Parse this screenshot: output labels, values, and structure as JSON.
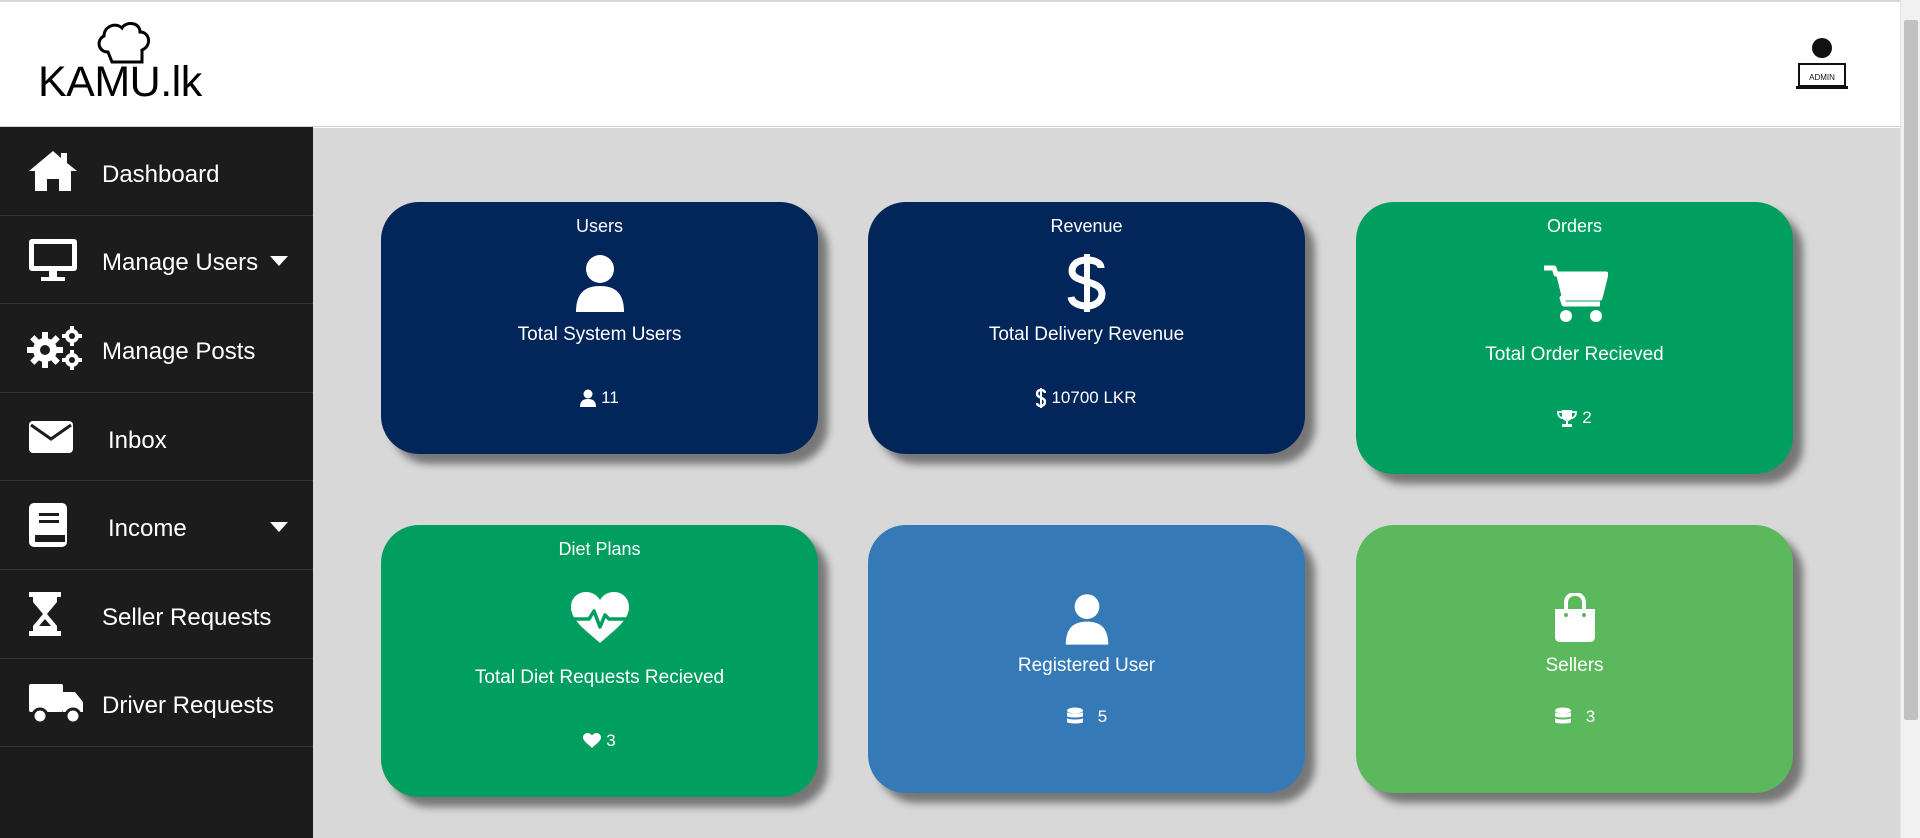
{
  "header": {
    "logo_text": "KAMU.lk",
    "avatar_label": "ADMIN"
  },
  "sidebar": {
    "items": [
      {
        "label": "Dashboard",
        "icon": "home-icon",
        "has_dropdown": false
      },
      {
        "label": "Manage Users",
        "icon": "desktop-icon",
        "has_dropdown": true
      },
      {
        "label": "Manage Posts",
        "icon": "gears-icon",
        "has_dropdown": false
      },
      {
        "label": "Inbox",
        "icon": "envelope-icon",
        "has_dropdown": false
      },
      {
        "label": "Income",
        "icon": "book-icon",
        "has_dropdown": true
      },
      {
        "label": "Seller Requests",
        "icon": "hourglass-icon",
        "has_dropdown": false
      },
      {
        "label": "Driver Requests",
        "icon": "truck-icon",
        "has_dropdown": false
      }
    ]
  },
  "cards": [
    {
      "title": "Users",
      "subtitle": "Total System Users",
      "value": "11",
      "icon": "user-icon",
      "stat_icon": "user-icon",
      "color": "#02265a"
    },
    {
      "title": "Revenue",
      "subtitle": "Total Delivery Revenue",
      "value": "10700 LKR",
      "icon": "dollar-icon",
      "stat_icon": "dollar-icon",
      "color": "#02265a"
    },
    {
      "title": "Orders",
      "subtitle": "Total Order Recieved",
      "value": "2",
      "icon": "cart-icon",
      "stat_icon": "trophy-icon",
      "color": "#019f5f"
    },
    {
      "title": "Diet Plans",
      "subtitle": "Total Diet Requests Recieved",
      "value": "3",
      "icon": "heartbeat-icon",
      "stat_icon": "heart-icon",
      "color": "#019f5f"
    },
    {
      "title": "",
      "subtitle": "Registered User",
      "value": "5",
      "icon": "user-icon",
      "stat_icon": "database-icon",
      "color": "#357ab7"
    },
    {
      "title": "",
      "subtitle": "Sellers",
      "value": "3",
      "icon": "shopping-bag-icon",
      "stat_icon": "database-icon",
      "color": "#5cb85c"
    }
  ],
  "colors": {
    "sidebar_bg": "#1c1c1c",
    "main_bg": "#d8d8d8",
    "navy": "#02265a",
    "green": "#019f5f",
    "blue": "#357ab7",
    "light_green": "#5cb85c"
  }
}
